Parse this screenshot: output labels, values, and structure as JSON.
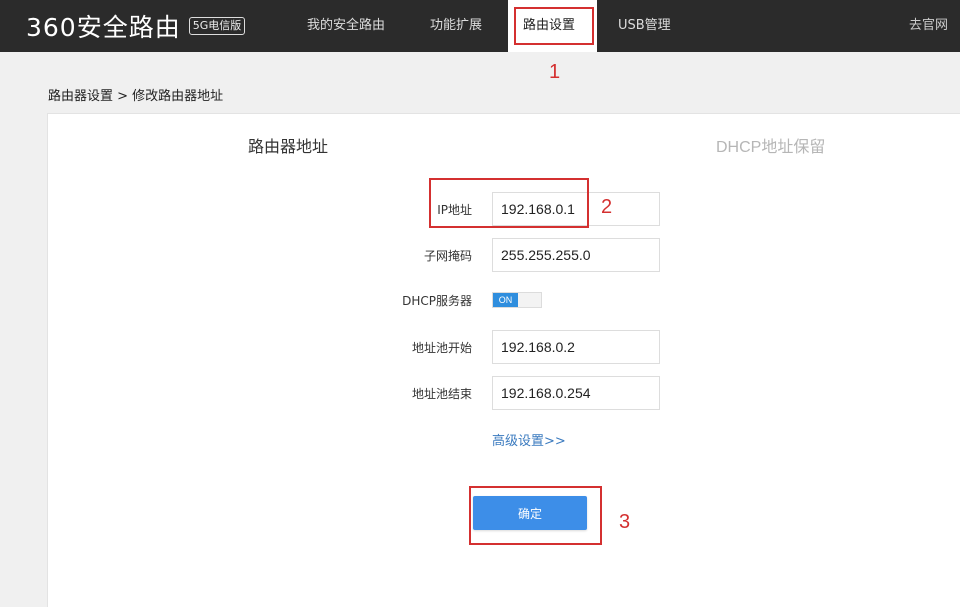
{
  "nav": {
    "logo_text": "360安全路由",
    "logo_badge": "5G电信版",
    "items": [
      {
        "label": "我的安全路由"
      },
      {
        "label": "功能扩展"
      },
      {
        "label": "路由设置"
      },
      {
        "label": "USB管理"
      }
    ],
    "right_link": "去官网"
  },
  "breadcrumb": "路由器设置 > 修改路由器地址",
  "tabs": {
    "active": "路由器地址",
    "inactive": "DHCP地址保留"
  },
  "form": {
    "ip_label": "IP地址",
    "ip_value": "192.168.0.1",
    "mask_label": "子网掩码",
    "mask_value": "255.255.255.0",
    "dhcp_label": "DHCP服务器",
    "dhcp_state": "ON",
    "pool_start_label": "地址池开始",
    "pool_start_value": "192.168.0.2",
    "pool_end_label": "地址池结束",
    "pool_end_value": "192.168.0.254",
    "advanced_link": "高级设置>>",
    "confirm_label": "确定"
  },
  "annotations": {
    "n1": "1",
    "n2": "2",
    "n3": "3"
  },
  "colors": {
    "topbar": "#2b2b2b",
    "accent": "#3d8ee8",
    "annotation": "#d43030"
  }
}
